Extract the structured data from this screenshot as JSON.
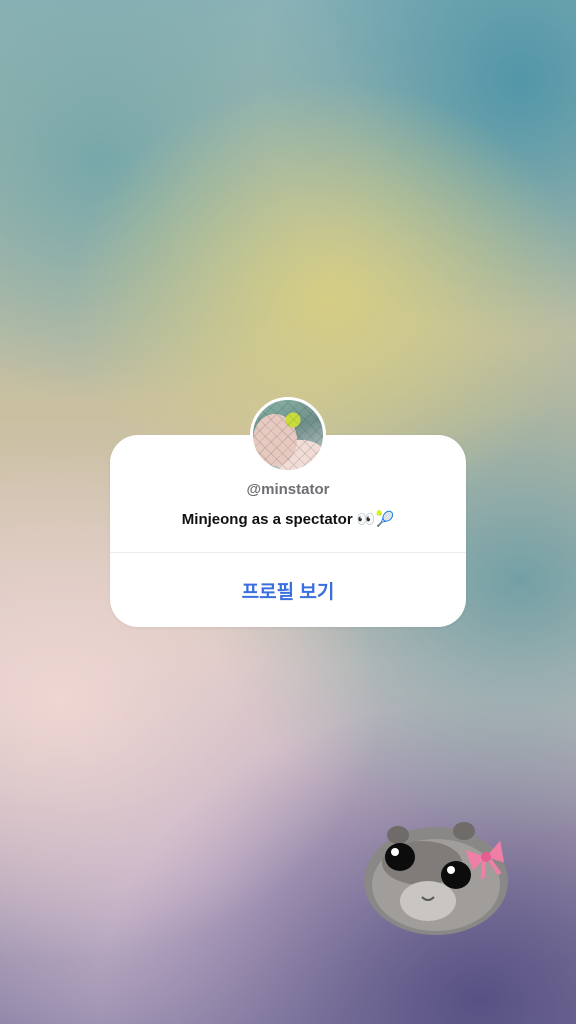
{
  "card": {
    "username": "@minstator",
    "message": "Minjeong as a spectator 👀🎾",
    "button_label": "프로필 보기"
  },
  "icons": {
    "avatar": "profile-photo",
    "sticker": "hamster-with-pink-bow-sticker"
  },
  "colors": {
    "link": "#3c6fde",
    "username": "#6e6e73",
    "card_background": "#ffffff"
  }
}
